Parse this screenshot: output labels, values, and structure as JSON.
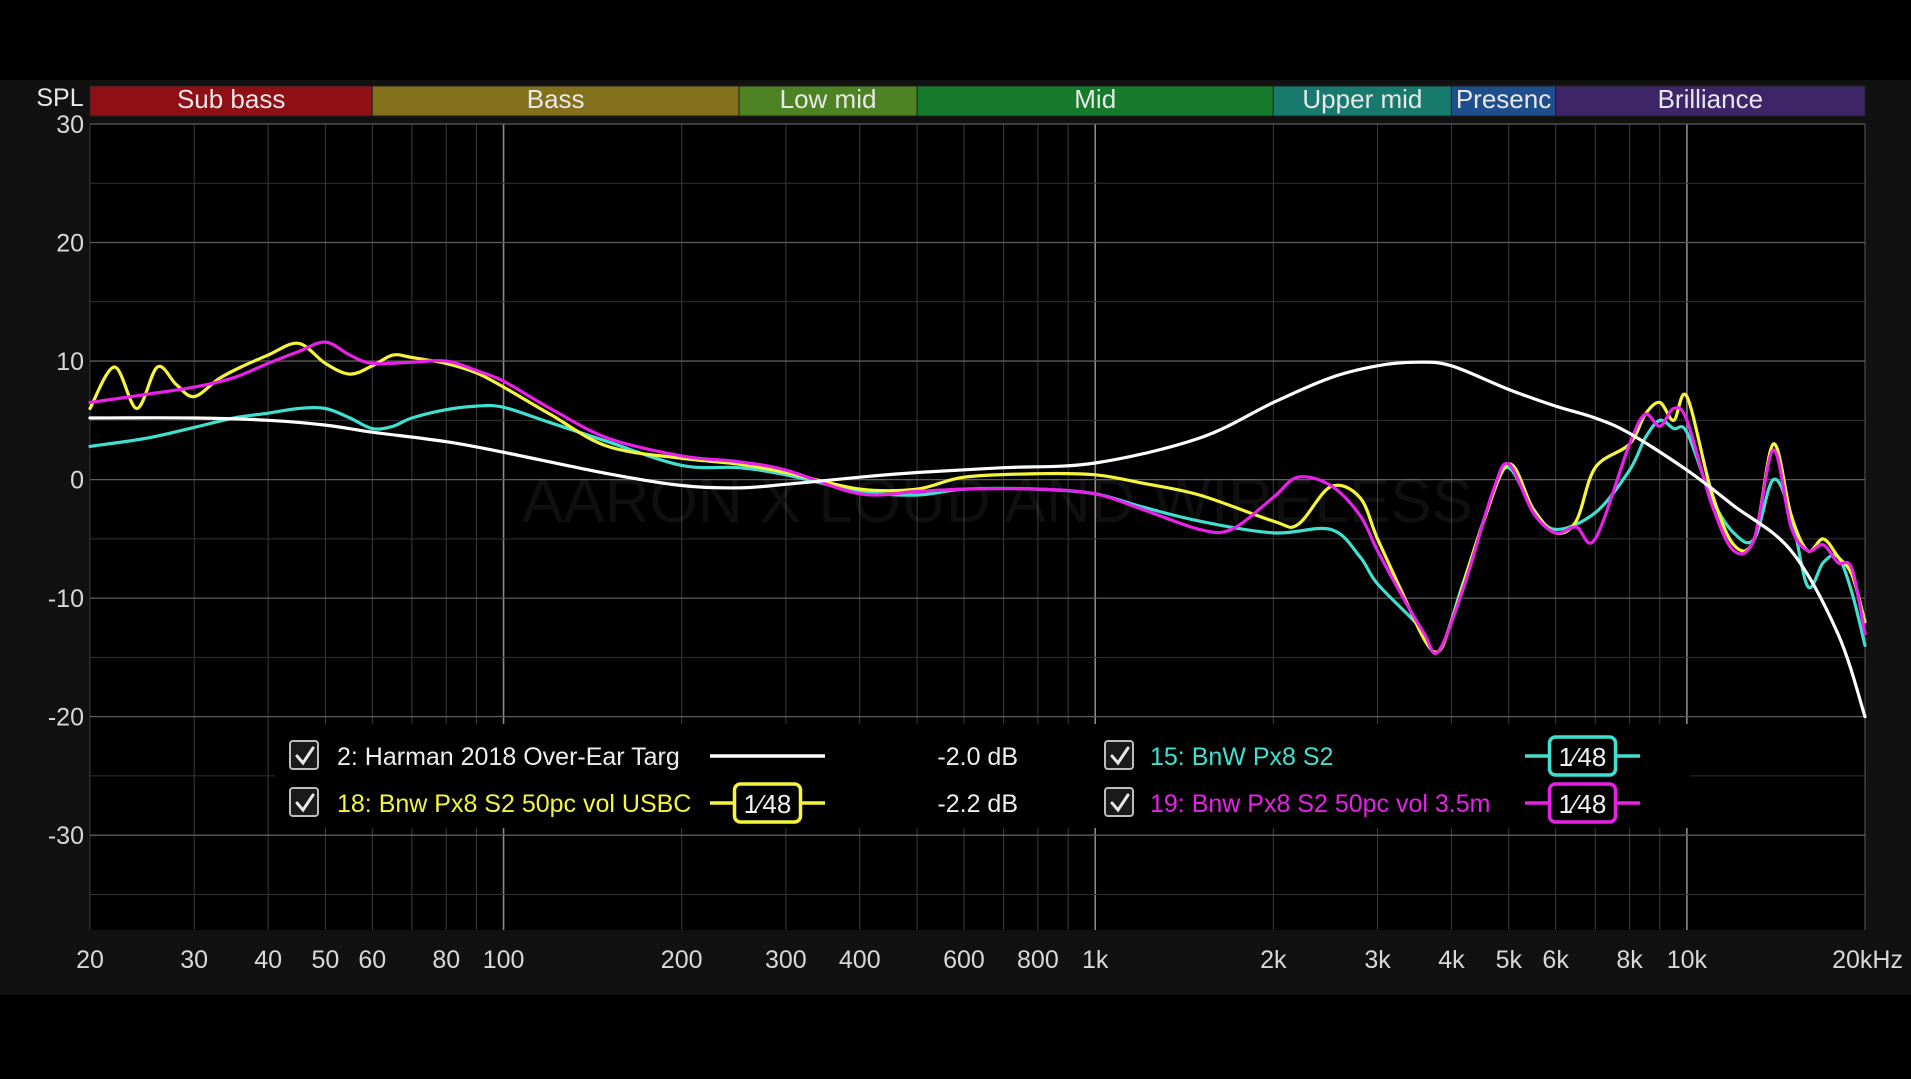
{
  "chart_data": {
    "type": "line",
    "ylabel": "SPL",
    "x_unit_suffix": "Hz",
    "x_scale": "log",
    "xlim": [
      20,
      20000
    ],
    "ylim": [
      -38,
      30
    ],
    "grid": true,
    "y_ticks": [
      30,
      20,
      10,
      0,
      -10,
      -20,
      -30
    ],
    "y_tick_labels": [
      "30",
      "20",
      "10",
      "0",
      "-10",
      "-20",
      "-30"
    ],
    "x_ticks": [
      20,
      30,
      40,
      50,
      60,
      80,
      100,
      200,
      300,
      400,
      600,
      800,
      1000,
      2000,
      3000,
      4000,
      5000,
      6000,
      8000,
      10000,
      20000
    ],
    "x_tick_labels": [
      "20",
      "30",
      "40",
      "50",
      "60",
      "80",
      "100",
      "200",
      "300",
      "400",
      "600",
      "800",
      "1k",
      "2k",
      "3k",
      "4k",
      "5k",
      "6k",
      "8k",
      "10k",
      "20k"
    ],
    "bands": [
      {
        "label": "Sub bass",
        "from": 20,
        "to": 60,
        "color": "#8e0f16"
      },
      {
        "label": "Bass",
        "from": 60,
        "to": 250,
        "color": "#82701c"
      },
      {
        "label": "Low mid",
        "from": 250,
        "to": 500,
        "color": "#4e8323"
      },
      {
        "label": "Mid",
        "from": 500,
        "to": 2000,
        "color": "#157b2b"
      },
      {
        "label": "Upper mid",
        "from": 2000,
        "to": 4000,
        "color": "#177a6c"
      },
      {
        "label": "Presenc",
        "from": 4000,
        "to": 6000,
        "color": "#1e4f8c"
      },
      {
        "label": "Brilliance",
        "from": 6000,
        "to": 20000,
        "color": "#3d2568"
      }
    ],
    "watermark": "AARON X LOUD AND WIRELESS",
    "series": [
      {
        "name": "2: Harman 2018 Over-Ear Targ",
        "color": "#ffffff",
        "offset": "-2.0 dB",
        "smoothing": null,
        "checked": true,
        "x": [
          20,
          30,
          40,
          50,
          60,
          80,
          100,
          150,
          200,
          250,
          300,
          400,
          500,
          700,
          1000,
          1500,
          2000,
          2500,
          3000,
          3500,
          4000,
          5000,
          6000,
          7000,
          8000,
          10000,
          12000,
          15000,
          18000,
          20000
        ],
        "y": [
          5.2,
          5.2,
          5.0,
          4.6,
          4.0,
          3.2,
          2.3,
          0.5,
          -0.5,
          -0.7,
          -0.4,
          0.2,
          0.6,
          1.0,
          1.4,
          3.5,
          6.5,
          8.6,
          9.6,
          9.9,
          9.6,
          7.6,
          6.2,
          5.2,
          3.9,
          0.8,
          -2.2,
          -6.0,
          -13.0,
          -20.0
        ]
      },
      {
        "name": "15: BnW Px8 S2",
        "color": "#40e0d0",
        "offset": "",
        "smoothing": "1⁄48",
        "checked": true,
        "x": [
          20,
          25,
          30,
          35,
          40,
          45,
          50,
          55,
          60,
          65,
          70,
          80,
          90,
          100,
          120,
          150,
          200,
          250,
          300,
          400,
          500,
          600,
          800,
          1000,
          1200,
          1500,
          2000,
          2500,
          2800,
          3000,
          3500,
          3800,
          4200,
          4700,
          5000,
          5500,
          6000,
          7000,
          8000,
          8500,
          9000,
          9500,
          10000,
          11000,
          12000,
          13000,
          14000,
          15000,
          16000,
          17000,
          18000,
          19000,
          20000
        ],
        "y": [
          2.8,
          3.5,
          4.4,
          5.2,
          5.6,
          6.0,
          6.0,
          5.2,
          4.3,
          4.5,
          5.2,
          5.9,
          6.2,
          6.1,
          4.8,
          3.2,
          1.2,
          1.0,
          0.4,
          -1.0,
          -1.3,
          -0.8,
          -0.8,
          -1.2,
          -2.3,
          -3.5,
          -4.5,
          -4.2,
          -6.5,
          -8.8,
          -12.2,
          -14.5,
          -8.5,
          -1.2,
          1.0,
          -2.5,
          -4.2,
          -2.8,
          0.8,
          3.5,
          5.0,
          4.3,
          4.0,
          -1.5,
          -4.5,
          -5.0,
          0.0,
          -3.0,
          -9.0,
          -7.0,
          -6.5,
          -9.5,
          -14.0
        ]
      },
      {
        "name": "18: Bnw Px8 S2 50pc vol USBC",
        "color": "#f5f53c",
        "offset": "-2.2 dB",
        "smoothing": "1⁄48",
        "checked": true,
        "x": [
          20,
          22,
          24,
          26,
          28,
          30,
          33,
          36,
          40,
          45,
          50,
          55,
          60,
          65,
          70,
          80,
          90,
          100,
          120,
          150,
          200,
          250,
          300,
          400,
          500,
          600,
          800,
          1000,
          1200,
          1500,
          2000,
          2200,
          2500,
          2800,
          3000,
          3300,
          3600,
          3800,
          4000,
          4500,
          5000,
          5500,
          6000,
          6500,
          7000,
          8000,
          8500,
          9000,
          9500,
          10000,
          11000,
          12000,
          13000,
          14000,
          15000,
          16000,
          17000,
          18000,
          19000,
          20000
        ],
        "y": [
          6.0,
          9.5,
          6.0,
          9.5,
          8.0,
          7.0,
          8.5,
          9.5,
          10.5,
          11.5,
          9.8,
          8.9,
          9.6,
          10.5,
          10.3,
          9.8,
          9.0,
          7.8,
          5.5,
          2.8,
          1.8,
          1.3,
          0.6,
          -0.8,
          -0.8,
          0.2,
          0.5,
          0.4,
          -0.3,
          -1.3,
          -3.5,
          -3.8,
          -0.6,
          -1.5,
          -5.0,
          -9.5,
          -13.5,
          -14.5,
          -12.0,
          -4.0,
          1.3,
          -2.5,
          -4.5,
          -3.5,
          1.0,
          3.0,
          5.5,
          6.5,
          5.0,
          7.0,
          -1.0,
          -5.5,
          -5.0,
          3.0,
          -3.0,
          -6.0,
          -5.0,
          -6.5,
          -8.0,
          -12.0
        ]
      },
      {
        "name": "19: Bnw Px8 S2 50pc vol 3.5m",
        "color": "#e820e8",
        "offset": "",
        "smoothing": "1⁄48",
        "checked": true,
        "x": [
          20,
          25,
          30,
          35,
          40,
          45,
          50,
          55,
          60,
          70,
          80,
          90,
          100,
          120,
          150,
          200,
          250,
          300,
          400,
          500,
          600,
          800,
          1000,
          1200,
          1500,
          1700,
          2000,
          2200,
          2500,
          2800,
          3000,
          3300,
          3600,
          3800,
          4200,
          4700,
          5000,
          5500,
          6000,
          6500,
          7000,
          8000,
          8500,
          9000,
          9500,
          10000,
          11000,
          12000,
          13000,
          14000,
          15000,
          16000,
          17000,
          18000,
          19000,
          20000
        ],
        "y": [
          6.5,
          7.2,
          7.8,
          8.6,
          9.8,
          10.8,
          11.6,
          10.5,
          9.8,
          9.9,
          10.0,
          9.2,
          8.3,
          6.0,
          3.5,
          2.0,
          1.5,
          0.8,
          -1.2,
          -1.0,
          -0.8,
          -0.8,
          -1.2,
          -2.5,
          -4.2,
          -4.2,
          -1.5,
          0.2,
          -0.5,
          -3.0,
          -6.0,
          -9.8,
          -13.0,
          -14.5,
          -9.0,
          -1.0,
          1.3,
          -2.8,
          -4.5,
          -4.0,
          -5.0,
          3.0,
          5.5,
          4.5,
          6.0,
          5.0,
          -2.0,
          -6.0,
          -5.0,
          2.5,
          -4.0,
          -6.0,
          -5.5,
          -7.0,
          -7.5,
          -13.0
        ]
      }
    ]
  }
}
